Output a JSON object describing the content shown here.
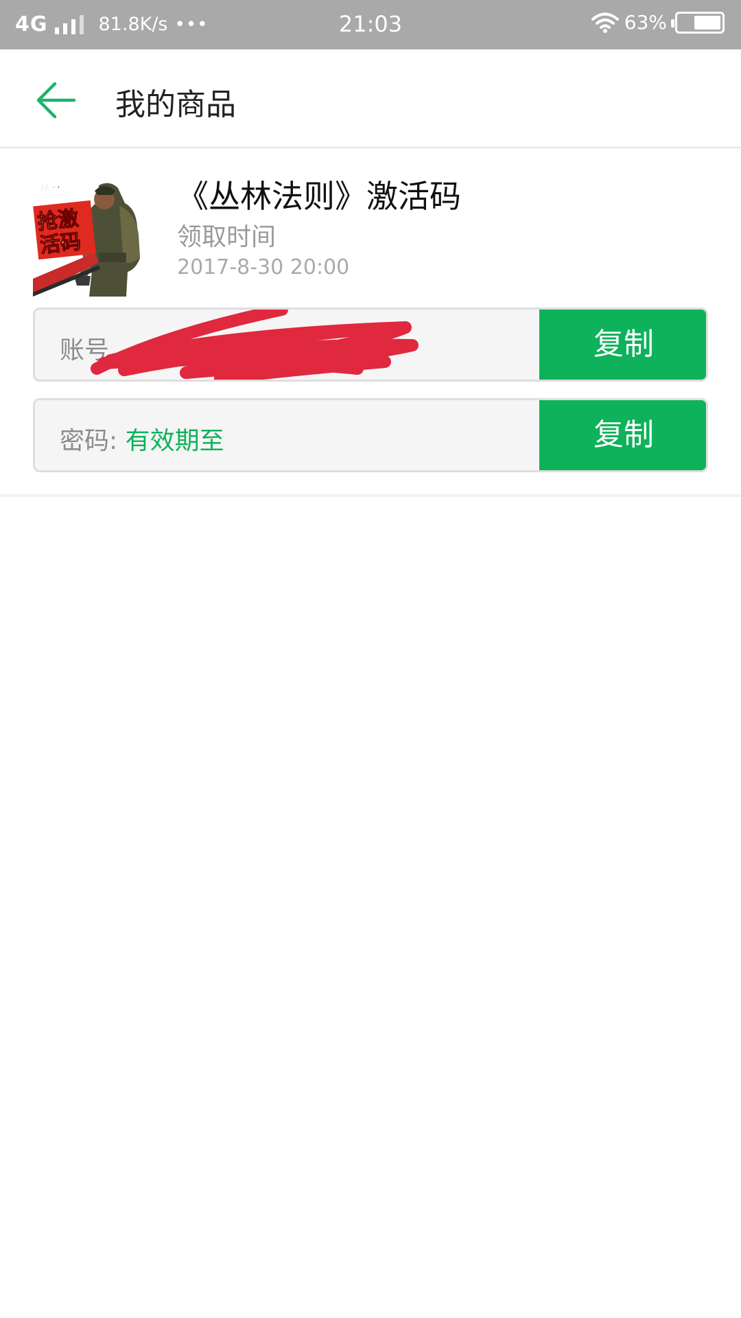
{
  "status_bar": {
    "network": "4G",
    "speed": "81.8K/s",
    "dots": "•••",
    "time": "21:03",
    "battery": "63%",
    "battery_level": 0.63
  },
  "header": {
    "title": "我的商品",
    "back_icon": "arrow-left-icon",
    "accent_color": "#1db36a"
  },
  "product": {
    "title": "《丛林法则》激活码",
    "receive_label": "领取时间",
    "receive_time": "2017-8-30 20:00",
    "thumbnail": {
      "banner_text": "丛林法则",
      "badge_text": "抢激活码"
    }
  },
  "codes": {
    "account": {
      "label": "账号",
      "copy_label": "复制"
    },
    "password": {
      "label": "密码:",
      "value": "有效期至",
      "copy_label": "复制"
    }
  },
  "colors": {
    "primary_green": "#0db25a",
    "status_bar_bg": "#a9a9a9",
    "redaction_red": "#e0283e"
  }
}
